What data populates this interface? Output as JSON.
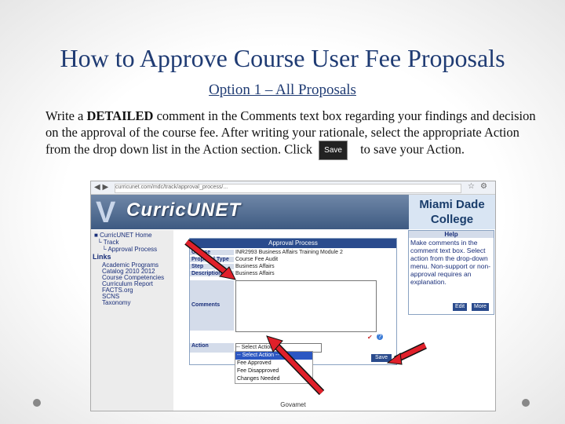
{
  "slide": {
    "title": "How to Approve Course User Fee Proposals",
    "subtitle": "Option 1 – All Proposals",
    "text_part1": "Write a ",
    "text_bold": "DETAILED",
    "text_part2": " comment in the Comments text box regarding your findings and decision on the approval of the course fee. After writing your rationale, select the appropriate Action from the drop down list in the Action section. Click ",
    "inline_button": "Save",
    "text_part3": " to save your Action."
  },
  "screenshot": {
    "url": "curricunet.com/mdc/track/approval_process/...",
    "logo": "CurricUNET",
    "college_line1": "Miami Dade",
    "college_line2": "College",
    "nav": {
      "home": "CurricUNET Home",
      "track": "Track",
      "approval": "Approval Process",
      "links_head": "Links",
      "links": [
        "Academic Programs",
        "Catalog 2010 2012",
        "Course Competencies",
        "Curriculum Report",
        "FACTS.org",
        "SCNS",
        "Taxonomy"
      ]
    },
    "panel": {
      "header": "Approval Process",
      "course_label": "Course",
      "course_value": "INR2993 Business Affairs Training Module 2",
      "proposal_label": "Proposal Type",
      "proposal_value": "Course Fee Audit",
      "step_label": "Step",
      "step_value": "Business Affairs",
      "desc_label": "Description",
      "desc_value": "Business Affairs",
      "comments_label": "Comments",
      "action_label": "Action",
      "action_value": "-- Select Action --",
      "save": "Save"
    },
    "dropdown": [
      "-- Select Action --",
      "Fee Approved",
      "Fee Disapproved",
      "Changes Needed"
    ],
    "help": {
      "title": "Help",
      "text": "Make comments in the comment text box. Select action from the drop-down menu. Non-support or non-approval requires an explanation.",
      "edit": "Edit",
      "more": "More"
    },
    "footer": "Govamet"
  }
}
